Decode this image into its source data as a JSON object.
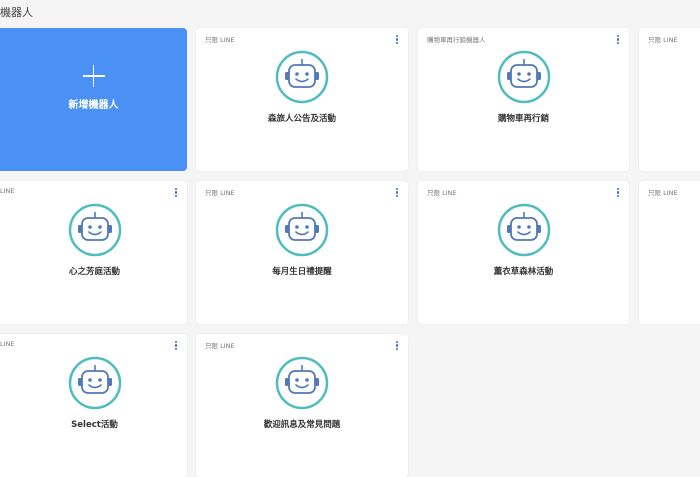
{
  "page": {
    "title": "機器人"
  },
  "add_card": {
    "label": "新增機器人"
  },
  "robot_icon": "robot-avatar-icon",
  "menu_icon": "kebab-menu-icon",
  "colors": {
    "accent": "#4a90f5",
    "robot_ring": "#4fbdbd",
    "robot_body": "#5378b8",
    "page_bg": "#f5f5f5"
  },
  "cards": [
    {
      "tag": "只限 LINE",
      "name": "森旅人公告及活動"
    },
    {
      "tag": "購物車再行銷機器人",
      "name": "購物車再行銷"
    },
    {
      "tag": "只限 LINE",
      "name": ""
    },
    {
      "tag": "LINE",
      "name": "心之芳庭活動"
    },
    {
      "tag": "只限 LINE",
      "name": "每月生日禮提醒"
    },
    {
      "tag": "只限 LINE",
      "name": "薰衣草森林活動"
    },
    {
      "tag": "只限 LINE",
      "name": ""
    },
    {
      "tag": "LINE",
      "name": "Select活動"
    },
    {
      "tag": "只限 LINE",
      "name": "歡迎訊息及常見問題"
    }
  ]
}
